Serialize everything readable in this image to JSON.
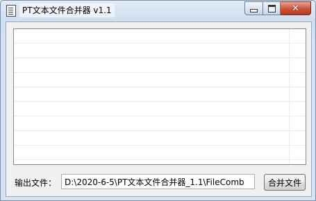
{
  "window": {
    "title": "PT文本文件合并器 v1.1"
  },
  "caption_buttons": {
    "close_symbol": "✕"
  },
  "file_list": {
    "rows": []
  },
  "output": {
    "label": "输出文件：",
    "path": "D:\\2020-6-5\\PT文本文件合并器_1.1\\FileComb"
  },
  "merge_button": {
    "label": "合并文件"
  }
}
